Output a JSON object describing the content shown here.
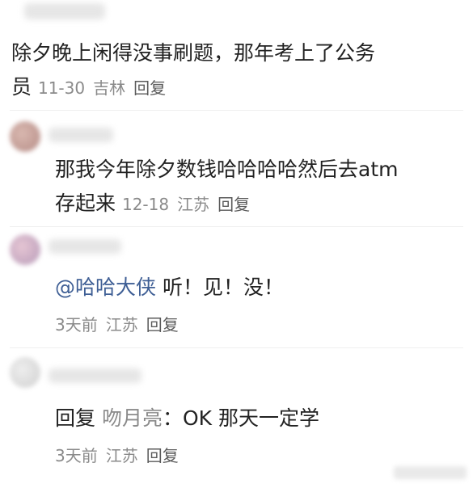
{
  "comments": [
    {
      "text_line1": "除夕晚上闲得没事刷题，那年考上了公务",
      "text_line2": "员",
      "date": "11-30",
      "location": "吉林",
      "reply_label": "回复"
    },
    {
      "text_line1": "那我今年除夕数钱哈哈哈哈然后去atm",
      "text_line2": "存起来",
      "date": "12-18",
      "location": "江苏",
      "reply_label": "回复"
    },
    {
      "mention": "@哈哈大侠",
      "text": " 听！见！没！",
      "date": "3天前",
      "location": "江苏",
      "reply_label": "回复"
    },
    {
      "reply_prefix": "回复",
      "reply_to": "吻月亮",
      "text": "：OK 那天一定学",
      "date": "3天前",
      "location": "江苏",
      "reply_label": "回复"
    }
  ]
}
